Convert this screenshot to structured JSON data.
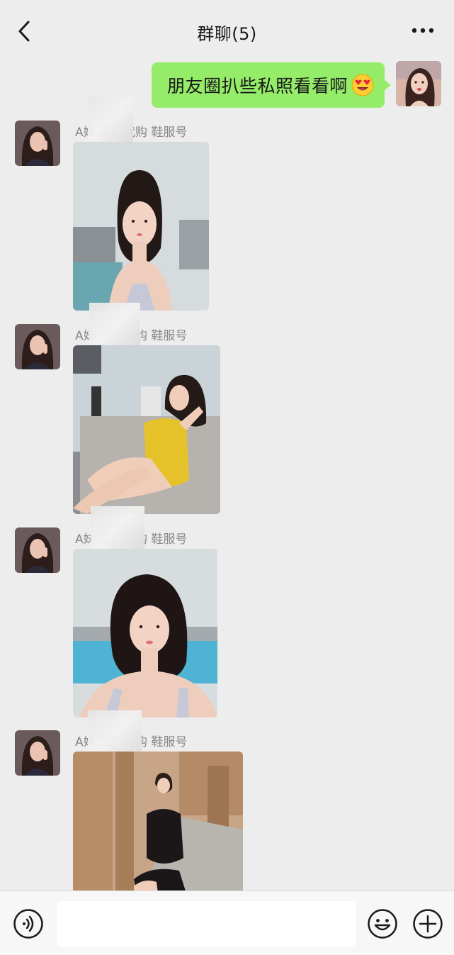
{
  "header": {
    "title": "群聊(5)",
    "back_icon": "chevron-left-icon",
    "more_icon": "ellipsis-icon"
  },
  "messages": [
    {
      "direction": "out",
      "text": "朋友圈扒些私照看看啊",
      "emoji": "heart-eyes-face"
    },
    {
      "direction": "in",
      "sender": "A妹  工厂代购 鞋服号",
      "content": "image"
    },
    {
      "direction": "in",
      "sender": "A妹  工厂代购 鞋服号",
      "content": "image"
    },
    {
      "direction": "in",
      "sender": "A妹  工厂代购 鞋服号",
      "content": "image"
    },
    {
      "direction": "in",
      "sender": "A妹  工厂代购 鞋服号",
      "content": "image"
    }
  ],
  "input_bar": {
    "placeholder": "",
    "voice_icon": "voice-icon",
    "emoji_icon": "smiley-icon",
    "plus_icon": "plus-icon"
  },
  "colors": {
    "background": "#ededed",
    "bubble_out": "#95ec69",
    "sender_text": "#888888"
  }
}
